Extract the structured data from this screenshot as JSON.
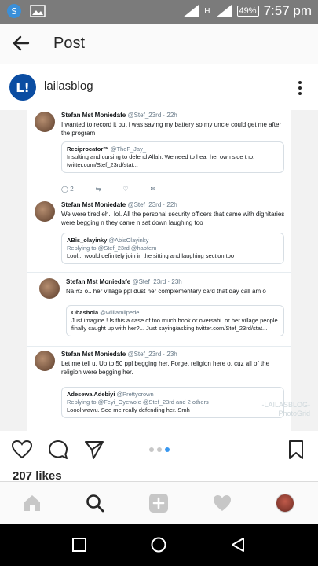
{
  "status_bar": {
    "battery": "49%",
    "time": "7:57 pm",
    "network": "H"
  },
  "app_bar": {
    "title": "Post"
  },
  "post": {
    "avatar_text": "L!",
    "username": "lailasblog",
    "likes": "207 likes"
  },
  "tweets": [
    {
      "name": "Stefan Mst Moniedafe",
      "meta": "@Stef_23rd · 22h",
      "body": "I wanted to record it but i was saving my battery so my uncle could get me after the program",
      "quote": {
        "name": "Reciprocator™",
        "meta": "@TheF_Jay_",
        "text": "Insulting and cursing to defend Allah. We need to hear her own side tho. twitter.com/Stef_23rd/stat..."
      },
      "reply_count": "2"
    },
    {
      "name": "Stefan Mst Moniedafe",
      "meta": "@Stef_23rd · 22h",
      "body": "We were tired eh.. lol. All the personal security officers that came with dignitaries were begging n they came n sat down laughing too",
      "quote": {
        "name": "ABis_olayinky",
        "meta": "@AbisOlayinky",
        "reply_to": "Replying to @Stef_23rd @habfem",
        "text": "Lool... would definitely join in the sitting and laughing section too"
      }
    },
    {
      "name": "Stefan Mst Moniedafe",
      "meta": "@Stef_23rd · 23h",
      "body": "Na #3 o.. her village ppl dust her complementary card that day call am o",
      "quote": {
        "name": "Obashola",
        "meta": "@williamlipede",
        "text": "Just imagine.! Is this a case of too much book or oversabi. or her village people finally caught up with her?... Just saying/asking twitter.com/Stef_23rd/stat..."
      }
    },
    {
      "name": "Stefan Mst Moniedafe",
      "meta": "@Stef_23rd · 23h",
      "body": "Let me tell u. Up to 50 ppl begging her. Forget religion here o. cuz all of the religion were begging her.",
      "quote": {
        "name": "Adesewa Adebiyi",
        "meta": "@Prettycrown",
        "reply_to": "Replying to @Feyi_Oyewole @Stef_23rd and 2 others",
        "text": "Loool wawu. See me really defending her. Smh"
      }
    }
  ],
  "watermark": {
    "line1": "-LAILASBLOG-",
    "line2": "PhotoGrid"
  },
  "icons": {
    "back": "arrow-left-icon",
    "more": "more-vertical-icon",
    "like": "heart-icon",
    "comment": "comment-icon",
    "share": "send-icon",
    "save": "bookmark-icon",
    "home": "home-icon",
    "search": "search-icon",
    "add": "add-icon",
    "activity": "heart-icon",
    "profile": "profile-avatar"
  },
  "colors": {
    "brand_blue": "#0b4da2",
    "carousel_active": "#3897f0",
    "status_bar": "#7b7b7b"
  },
  "carousel": {
    "count": 3,
    "active_index": 2
  }
}
